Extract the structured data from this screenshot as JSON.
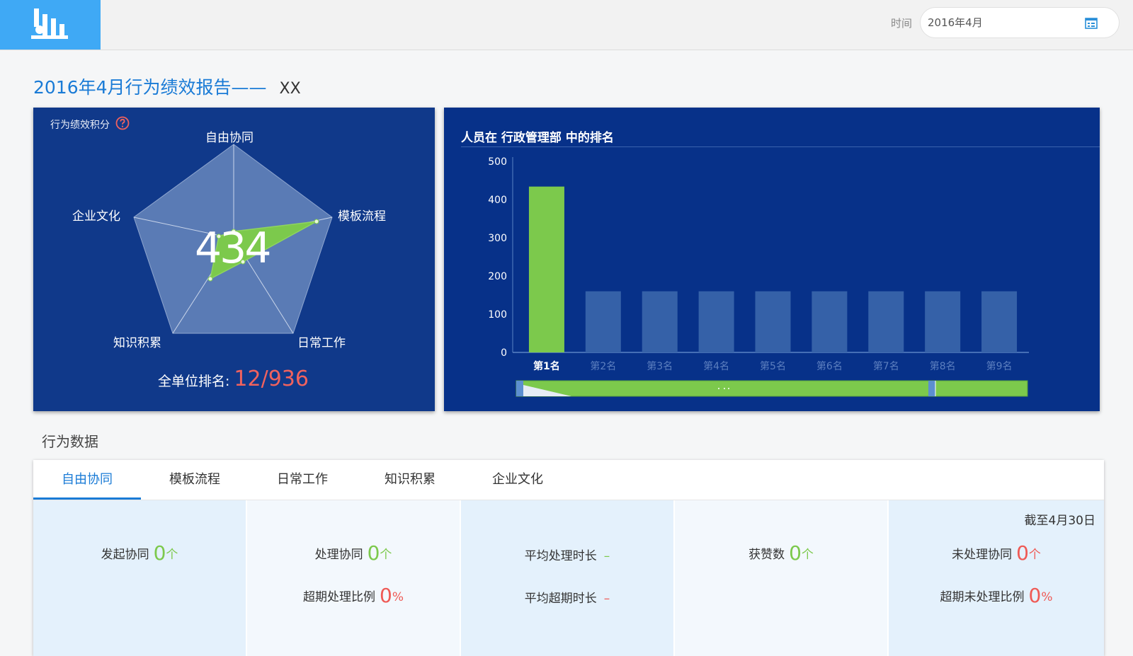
{
  "header": {
    "time_label": "时间",
    "date_value": "2016年4月",
    "logo_icon": "bar-chart-logo-icon",
    "calendar_icon": "calendar-icon"
  },
  "report": {
    "title": "2016年4月行为绩效报告——",
    "name": "XX"
  },
  "radar_panel": {
    "label": "行为绩效积分",
    "help_icon": "question-icon",
    "score": "434",
    "axes": [
      "自由协同",
      "模板流程",
      "日常工作",
      "知识积累",
      "企业文化"
    ],
    "rank_label": "全单位排名:",
    "rank_value": "12/936",
    "colors": {
      "bg": "#10398a",
      "polygon": "#5a7bb5",
      "area": "#7cc94c"
    }
  },
  "bar_panel": {
    "title": "人员在 行政管理部 中的排名",
    "colors": {
      "highlight": "#7cc94c",
      "others": "#3561a8"
    }
  },
  "chart_data": {
    "type": "bar",
    "title": "人员在 行政管理部 中的排名",
    "categories": [
      "第1名",
      "第2名",
      "第3名",
      "第4名",
      "第5名",
      "第6名",
      "第7名",
      "第8名",
      "第9名"
    ],
    "values": [
      434,
      160,
      160,
      160,
      160,
      160,
      160,
      160,
      160
    ],
    "y_ticks": [
      "0",
      "100",
      "200",
      "300",
      "400",
      "500"
    ],
    "ylim": [
      0,
      500
    ],
    "grid": false
  },
  "section": {
    "title": "行为数据"
  },
  "tabs": [
    {
      "label": "自由协同",
      "active": true
    },
    {
      "label": "模板流程",
      "active": false
    },
    {
      "label": "日常工作",
      "active": false
    },
    {
      "label": "知识积累",
      "active": false
    },
    {
      "label": "企业文化",
      "active": false
    }
  ],
  "stats": {
    "as_of": "截至4月30日",
    "initiated": {
      "label": "发起协同",
      "value": "0",
      "unit": "个"
    },
    "handled": {
      "label": "处理协同",
      "value": "0",
      "unit": "个"
    },
    "overdue_ratio": {
      "label": "超期处理比例",
      "value": "0",
      "unit": "%"
    },
    "avg_handle": {
      "label": "平均处理时长",
      "value": "–"
    },
    "avg_overdue": {
      "label": "平均超期时长",
      "value": "–"
    },
    "likes": {
      "label": "获赞数",
      "value": "0",
      "unit": "个"
    },
    "pending": {
      "label": "未处理协同",
      "value": "0",
      "unit": "个"
    },
    "pending_overdue_ratio": {
      "label": "超期未处理比例",
      "value": "0",
      "unit": "%"
    }
  }
}
